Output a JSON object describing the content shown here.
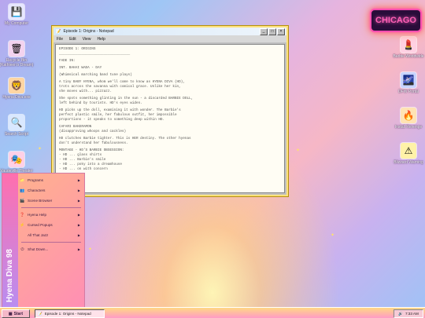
{
  "desktop": {
    "left_icons": [
      {
        "label": "My Computer",
        "icon": "floppy-icon",
        "glyph": "💾",
        "bg": "#e7e7ff"
      },
      {
        "label": "Recycle Bin (Kathleen's Dream)",
        "icon": "recycle-bin-icon",
        "glyph": "🗑",
        "bg": "#f3d3ef"
      },
      {
        "label": "Hyena Diva.exe",
        "icon": "hyena-icon",
        "glyph": "🦁",
        "bg": "#ffd6a3"
      },
      {
        "label": "Search Script",
        "icon": "magnifier-icon",
        "glyph": "🔍",
        "bg": "#d9e8ff"
      },
      {
        "label": "Vaudeville Theater",
        "icon": "theater-icon",
        "glyph": "🎭",
        "bg": "#ffd0e6"
      }
    ],
    "right_icons": [
      {
        "label": "Barbie Worldwide",
        "icon": "barbie-icon",
        "glyph": "💄",
        "bg": "#ffd1e3"
      },
      {
        "label": "DFW Portal",
        "icon": "portal-icon",
        "glyph": "🌌",
        "bg": "#c8d4ff"
      },
      {
        "label": "Install Revenge",
        "icon": "revenge-icon",
        "glyph": "🔥",
        "bg": "#ffe3b3"
      },
      {
        "label": "Blizzard Warning",
        "icon": "warning-icon",
        "glyph": "⚠",
        "bg": "#fff2a8"
      }
    ],
    "neon_sign": "CHICAGO"
  },
  "notepad": {
    "title": "Episode 1: Origins - Notepad",
    "menu": [
      "File",
      "Edit",
      "View",
      "Help"
    ],
    "lines": [
      "EPISODE 1: ORIGINS\n___________________________________",
      "FADE IN:",
      "INT. BAHAI WADA - DAY",
      "(Whimsical marching band tune plays)",
      "A tiny BABY HYENA, whom we'll come to know as HYENA DIVA (HD),\ntrots across the savanna with comical grace. Unlike her kin,\nshe moves with... pizzazz.",
      "She spots something glinting in the sun - a discarded BARBIE DOLL,\nleft behind by tourists. HD's eyes widen.",
      "HD picks up the doll, examining it with wonder. The Barbie's\nperfect plastic smile, her fabulous outfit, her impossible\nproportions - it speaks to something deep within HD.",
      "CAFARI BAKERAMON\n(disapproving whoops and cackles)",
      "HD clutches Barbie tighter. This is HER destiny. The other hyenas\ndon't understand her fabulousness.",
      "MONTAGE - HD'S BARBIE OBSESSION:\n- HD ... glass shirts\n- HD ... Barbie's smile\n- HD ... poky into a dreamhouse\n- HD ... on with concern"
    ]
  },
  "start_menu": {
    "side_label": "Hyena Diva 98",
    "items": [
      {
        "label": "Programs",
        "icon": "folder-icon",
        "glyph": "📁",
        "arrow": true
      },
      {
        "label": "Characters",
        "icon": "characters-icon",
        "glyph": "👥",
        "arrow": true
      },
      {
        "label": "Scene Browser",
        "icon": "scene-icon",
        "glyph": "🎬",
        "arrow": true
      },
      {
        "sep": true
      },
      {
        "label": "Hyena Help",
        "icon": "help-icon",
        "glyph": "❓",
        "arrow": true
      },
      {
        "label": "Cursed Popups",
        "icon": "popup-icon",
        "glyph": "⚡",
        "arrow": true
      },
      {
        "label": "All That Jazz",
        "icon": "jazz-icon",
        "glyph": "",
        "arrow": true
      },
      {
        "sep": true
      },
      {
        "label": "Shut Down...",
        "icon": "shutdown-icon",
        "glyph": "⏻",
        "arrow": true
      }
    ]
  },
  "taskbar": {
    "start_label": "Start",
    "task_label": "Episode 1: Origins - Notepad",
    "clock": "7:33 AM"
  }
}
